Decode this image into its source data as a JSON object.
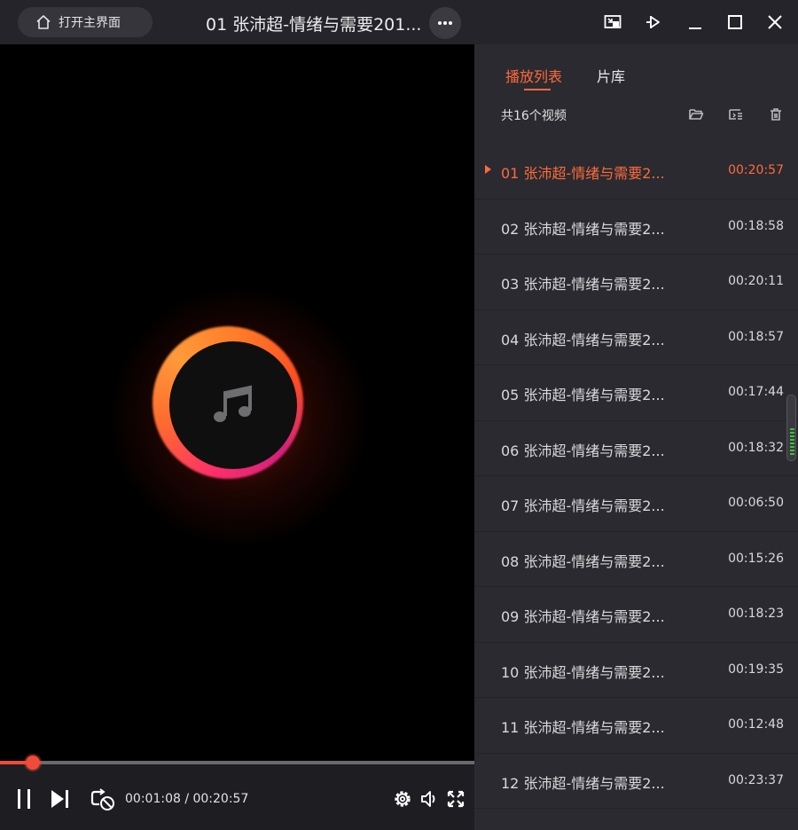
{
  "window": {
    "home_label": "打开主界面",
    "title": "01 张沛超-情绪与需要201..."
  },
  "controls": {
    "current_time": "00:01:08",
    "total_time": "00:20:57",
    "time_display": "00:01:08 / 00:20:57",
    "progress_fraction": 0.054
  },
  "panel": {
    "tabs": [
      {
        "label": "播放列表",
        "active": true
      },
      {
        "label": "片库",
        "active": false
      }
    ],
    "count_label": "共16个视频",
    "items": [
      {
        "title": "01 张沛超-情绪与需要2...",
        "duration": "00:20:57",
        "playing": true
      },
      {
        "title": "02 张沛超-情绪与需要2...",
        "duration": "00:18:58",
        "playing": false
      },
      {
        "title": "03 张沛超-情绪与需要2...",
        "duration": "00:20:11",
        "playing": false
      },
      {
        "title": "04 张沛超-情绪与需要2...",
        "duration": "00:18:57",
        "playing": false
      },
      {
        "title": "05 张沛超-情绪与需要2...",
        "duration": "00:17:44",
        "playing": false
      },
      {
        "title": "06 张沛超-情绪与需要2...",
        "duration": "00:18:32",
        "playing": false
      },
      {
        "title": "07 张沛超-情绪与需要2...",
        "duration": "00:06:50",
        "playing": false
      },
      {
        "title": "08 张沛超-情绪与需要2...",
        "duration": "00:15:26",
        "playing": false
      },
      {
        "title": "09 张沛超-情绪与需要2...",
        "duration": "00:18:23",
        "playing": false
      },
      {
        "title": "10 张沛超-情绪与需要2...",
        "duration": "00:19:35",
        "playing": false
      },
      {
        "title": "11 张沛超-情绪与需要2...",
        "duration": "00:12:48",
        "playing": false
      },
      {
        "title": "12 张沛超-情绪与需要2...",
        "duration": "00:23:37",
        "playing": false
      }
    ]
  },
  "theme": {
    "accent": "#ff6a3a",
    "progress": "#f24a3a",
    "panel_bg": "#2a2a30",
    "titlebar_bg": "#24242a"
  },
  "icons": [
    "home-icon",
    "more-icon",
    "mini-mode-icon",
    "pin-icon",
    "minimize-icon",
    "maximize-icon",
    "close-icon",
    "music-note-icon",
    "pause-icon",
    "next-icon",
    "loop-icon",
    "settings-icon",
    "volume-icon",
    "fullscreen-icon",
    "open-folder-icon",
    "sort-icon",
    "delete-icon"
  ]
}
